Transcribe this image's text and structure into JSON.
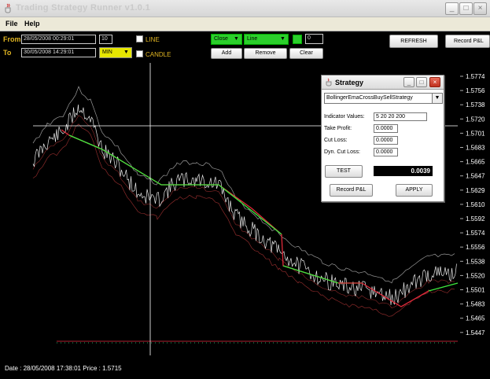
{
  "window": {
    "title": "Trading Strategy Runner v1.0.1",
    "controls": {
      "minimize": "_",
      "maximize": "□",
      "close": "×"
    }
  },
  "menu": {
    "file": "File",
    "help": "Help"
  },
  "toolbar": {
    "from_label": "From",
    "to_label": "To",
    "from_value": "28/05/2008 00:29:01",
    "to_value": "30/05/2008 14:29:01",
    "interval_value": "10",
    "unit_value": "MIN",
    "line_check": "LINE",
    "candle_check": "CANDLE",
    "price_field": "Close",
    "chart_type": "Line",
    "counter_value": "0",
    "add": "Add",
    "remove": "Remove",
    "clear": "Clear",
    "refresh": "REFRESH",
    "record_pl": "Record P&L"
  },
  "chart": {
    "price_labels": [
      "1.5774",
      "1.5756",
      "1.5738",
      "1.5720",
      "1.5701",
      "1.5683",
      "1.5665",
      "1.5647",
      "1.5629",
      "1.5610",
      "1.5592",
      "1.5574",
      "1.5556",
      "1.5538",
      "1.5520",
      "1.5501",
      "1.5483",
      "1.5465",
      "1.5447"
    ],
    "colors": {
      "background": "#000000",
      "price_line": "#e8e8e8",
      "band_upper": "#9a9a9a",
      "band_lower": "#8b2a2a",
      "buy_signal": "#3ee83e",
      "sell_signal": "#e02a3a",
      "crosshair": "#ffffff"
    }
  },
  "status": {
    "date_label": "Date :",
    "date_value": "28/05/2008 17:38:01",
    "price_label": "Price :",
    "price_value": "1.5715"
  },
  "strategy_dialog": {
    "title": "Strategy",
    "strategy_selected": "BollingerEmaCrossBuySellStrategy",
    "indicator_values_label": "Indicator Values:",
    "indicator_values": "5 20 20 200",
    "take_profit_label": "Take Profit:",
    "take_profit": "0.0000",
    "cut_loss_label": "Cut Loss:",
    "cut_loss": "0.0000",
    "dyn_cut_loss_label": "Dyn. Cut Loss:",
    "dyn_cut_loss": "0.0000",
    "test": "TEST",
    "result": "0.0039",
    "record_pl": "Record P&L",
    "apply": "APPLY"
  }
}
